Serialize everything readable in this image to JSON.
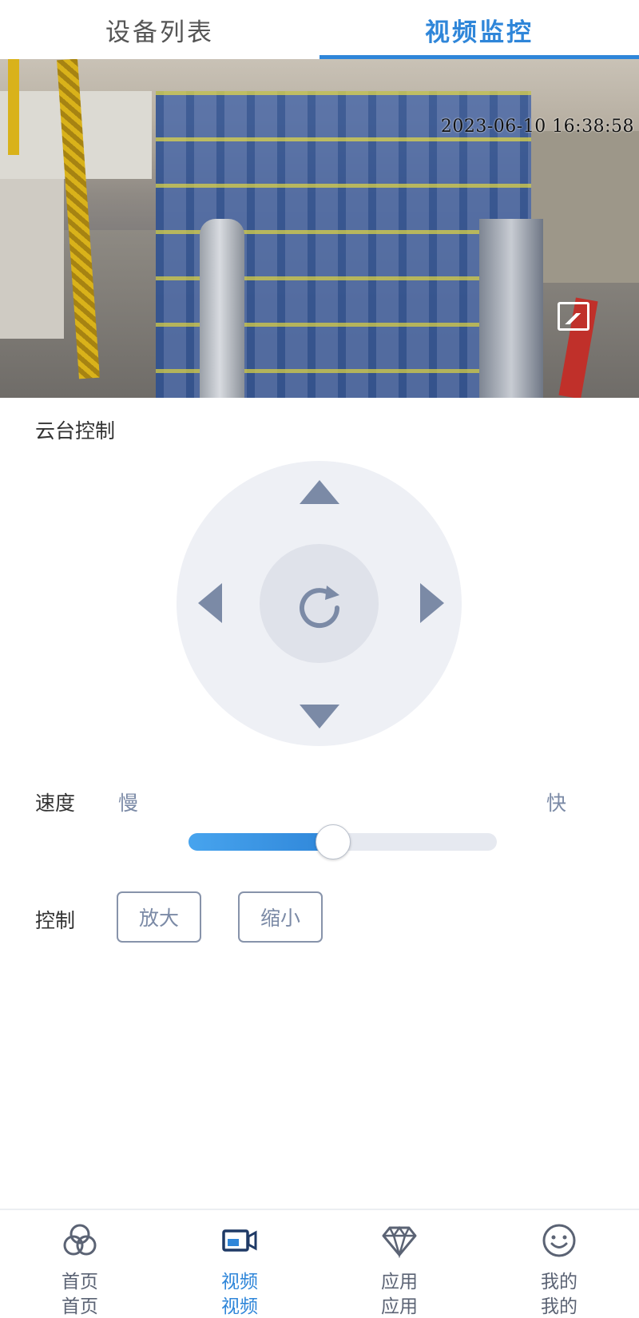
{
  "tabs": [
    {
      "label": "设备列表",
      "active": false
    },
    {
      "label": "视频监控",
      "active": true
    }
  ],
  "video": {
    "timestamp": "2023-06-10 16:38:58",
    "icons": [
      "snapshot-icon",
      "fullscreen-icon"
    ]
  },
  "ptz": {
    "title": "云台控制",
    "icons": [
      "arrow-up-icon",
      "arrow-down-icon",
      "arrow-left-icon",
      "arrow-right-icon",
      "refresh-icon"
    ]
  },
  "speed": {
    "label": "速度",
    "slow": "慢",
    "fast": "快",
    "value_fraction": 0.47
  },
  "zoom": {
    "label": "控制",
    "zoom_in": "放大",
    "zoom_out": "缩小"
  },
  "colors": {
    "accent": "#2f86d9",
    "muted": "#7b8aa6"
  },
  "nav": [
    {
      "label": "首页",
      "label2": "首页",
      "icon": "home-rings-icon",
      "active": false
    },
    {
      "label": "视频",
      "label2": "视频",
      "icon": "video-camera-icon",
      "active": true
    },
    {
      "label": "应用",
      "label2": "应用",
      "icon": "diamond-icon",
      "active": false
    },
    {
      "label": "我的",
      "label2": "我的",
      "icon": "smiley-icon",
      "active": false
    }
  ]
}
